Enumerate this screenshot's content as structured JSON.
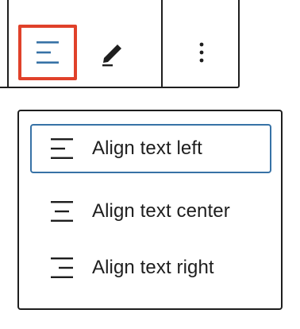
{
  "toolbar": {
    "align_button_icon": "align-left-icon",
    "edit_button_icon": "pencil-icon",
    "more_button_icon": "more-vertical-icon",
    "accent_color": "#3772a6",
    "highlight_color": "#e0412a"
  },
  "alignment_menu": {
    "items": [
      {
        "label": "Align text left",
        "icon": "align-left-icon",
        "focused": true
      },
      {
        "label": "Align text center",
        "icon": "align-center-icon",
        "focused": false
      },
      {
        "label": "Align text right",
        "icon": "align-right-icon",
        "focused": false
      }
    ],
    "focus_color": "#3772a6"
  }
}
